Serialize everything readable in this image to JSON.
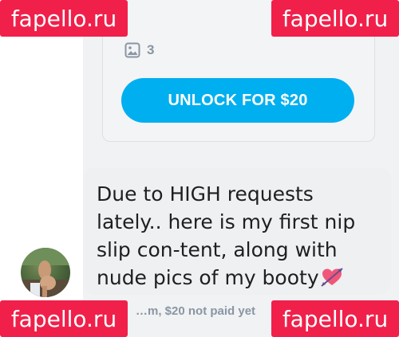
{
  "locked_post": {
    "media_icon": "image-icon",
    "media_count": "3",
    "unlock_label": "UNLOCK FOR $20"
  },
  "message": {
    "text": "Due to HIGH requests lately.. here is my first nip slip con-tent, along with nude pics of my booty",
    "emoji": "heart-with-arrow-icon"
  },
  "meta": {
    "status": "…m,  $20 not paid yet"
  },
  "watermark": {
    "text": "fapello.ru",
    "color": "#f0204a"
  },
  "colors": {
    "accent": "#00aff0",
    "muted": "#8a96a3"
  }
}
